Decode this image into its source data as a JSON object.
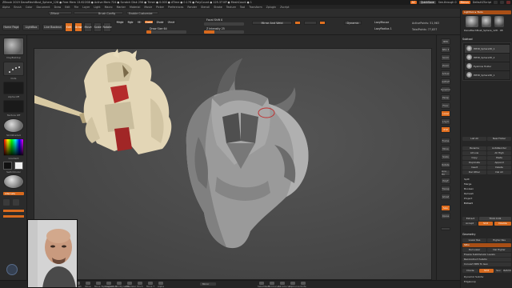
{
  "titlebar": {
    "title": "ZBrush 2019    DanaMechBust_Sphere_128    ● Free Mem 13.622GB  ● Active Mem 724  ● Scratch Disk 256  ● Timer ● 0.003 ● ATime ● 0.176  ● PolyCount ● 125.37 KP  ● MeshCount ● 1",
    "ac_label": "AC",
    "quicksave_label": "QuickSave",
    "seethrough_label": "See-through 0",
    "menus_label": "Menus",
    "defaultscript_label": "DefaultZScript"
  },
  "menubar": [
    "Alpha",
    "Brush",
    "Color",
    "Document",
    "Draw",
    "Edit",
    "File",
    "Layer",
    "Light",
    "Macro",
    "Marker",
    "Material",
    "Movie",
    "Picker",
    "Preferences",
    "Render",
    "Stencil",
    "Stroke",
    "Texture",
    "Tool",
    "Transform",
    "Zplugin",
    "Zscript"
  ],
  "strip1": {
    "field1": "ZMask",
    "field2": "Brush Config",
    "customize": "Enable Customize"
  },
  "toolbar": {
    "home_page": "Home Page",
    "lightbox": "LightBox",
    "live_boolean": "Live Boolean",
    "edit": "Edit",
    "draw": "Draw",
    "move": "Move",
    "scale": "Scale",
    "rotate": "Rotate",
    "mrgb": "Mrgb",
    "rgb": "Rgb",
    "m": "M",
    "zadd": "Zadd",
    "zsub": "Zsub",
    "zcut": "Zcut",
    "focal_shift": "Focal Shift 0",
    "draw_size": "Draw Size 64",
    "z_intensity": "Z Intensity 25",
    "rgb_intensity": "Rgb Intensity 100",
    "mirror_weld": "Mirror And Weld",
    "dynamic": "Dynamic",
    "active_points": "ActivePoints: 51,963",
    "total_points": "TotalPoints: 77,837",
    "lazymouse": "LazyMouse",
    "lazyradius": "LazyRadius 1"
  },
  "toolbar_sliders": {
    "focal_shift": 0.0,
    "draw_size": 0.12,
    "z_intensity": 0.25,
    "rgb_intensity": 1.0
  },
  "lefttray": {
    "brush_label": "ClayBuildup",
    "stroke_label": "Dots",
    "alpha_label": "Alpha Off",
    "texture_label": "Texture Off",
    "material_label": "SkinShade4",
    "gradient_label": "Gradient",
    "switch_color": "SwitchColor",
    "alternate": "Alternate"
  },
  "righticons": [
    "BPR",
    "SPix 3",
    "Scroll",
    "Zoom",
    "Actual",
    "AAHalf",
    "Dynamic",
    "Persp",
    "Floor",
    "Local",
    "L.Sym",
    "XYZ",
    "Frame",
    "Move",
    "Scale",
    "Rotate",
    "Line Fill",
    "PolyF",
    "Transp",
    "Ghost",
    "Solo",
    "Xpose"
  ],
  "rightpanel": {
    "lightbox_tools": "Lightbox ▸ Tools",
    "tool_name": "DanaMechBust_Sphere_128 . 48",
    "r_label": "R",
    "subtool_label": "Subtool",
    "subtool_items": [
      "PM3D_Sphere3D_1",
      "PM3D_Sphere3D_2",
      "Eyebrow Holder",
      "PM3D_Sphere3D_1"
    ],
    "list_all": "List All",
    "new_folder": "New Folder",
    "rename": "Rename",
    "autoreorder": "AutoReorder",
    "all_low": "All Low",
    "all_high": "All High",
    "copy": "Copy",
    "paste": "Paste",
    "duplicate": "Duplicate",
    "append": "Append",
    "insert": "Insert",
    "delete": "Delete",
    "del_other": "Del Other",
    "del_all": "Del All",
    "split": "Split",
    "merge": "Merge",
    "boolean": "Boolean",
    "remesh": "Remesh",
    "project": "Project",
    "extract": "Extract",
    "extract_btn": "Extract",
    "thick": "Thick 0.01",
    "accept": "Accept",
    "smt": "Smt",
    "double": "Double",
    "geometry": "Geometry",
    "lower_res": "Lower Res",
    "higher_res": "Higher Res",
    "sdiv": "SDiv",
    "del_lower": "Del Lower",
    "del_higher": "Del Higher",
    "freeze": "Freeze SubDivision Levels",
    "reconstruct": "Reconstruct Subdiv",
    "convert_bpr": "Convert BPR To Geo",
    "divide": "Divide",
    "suv": "Suv",
    "rsmt": "ReSmt",
    "dynamic_subdiv": "Dynamic Subdiv",
    "edgeloop": "EdgeLoop"
  },
  "bottombar": [
    "Standard",
    "ClayBuildup",
    "Dam_Standard",
    "Inflat",
    "hPolish",
    "Move",
    "Move Topological",
    "SnakeHook",
    "TrimDynamic",
    "ZModeler",
    "Pinch",
    "Move T",
    "Alpha",
    "Mirror"
  ],
  "bottom_extra": [
    "SelectRect",
    "TrimCurve",
    "SliceCurve",
    "ClipCurve",
    "Knife"
  ],
  "colors": {
    "accent": "#e07020",
    "background": "#2a2a2a",
    "canvas": "#4b4b4b",
    "model": "#9a9a9a"
  }
}
